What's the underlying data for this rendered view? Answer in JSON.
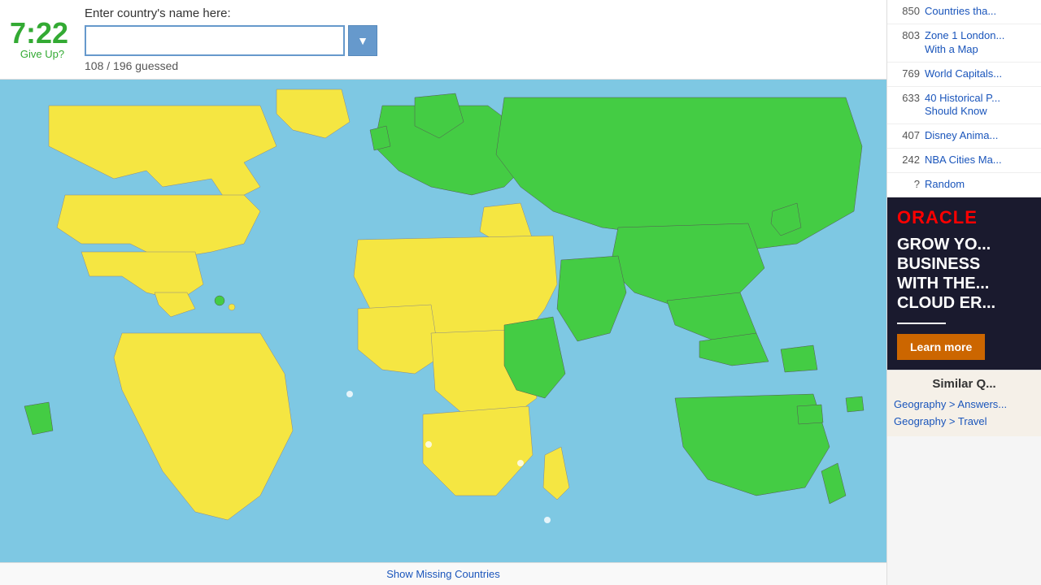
{
  "timer": {
    "display": "7:22",
    "color": "#33aa33"
  },
  "give_up": "Give Up?",
  "input": {
    "label": "Enter country's name here:",
    "placeholder": "",
    "value": ""
  },
  "progress": {
    "guessed": 108,
    "total": 196,
    "text": "108 / 196 guessed"
  },
  "dropdown_arrow": "▼",
  "sidebar": {
    "quiz_items": [
      {
        "count": "850",
        "label": "Countries tha..."
      },
      {
        "count": "803",
        "label": "Zone 1 London... With a Map"
      },
      {
        "count": "769",
        "label": "World Capitals..."
      },
      {
        "count": "633",
        "label": "40 Historical P... Should Know"
      },
      {
        "count": "407",
        "label": "Disney Anima..."
      },
      {
        "count": "242",
        "label": "NBA Cities Ma..."
      },
      {
        "count": "?",
        "label": "Random"
      }
    ],
    "ad": {
      "logo": "ORACLE",
      "text": "GROW YO... BUSINESS WITH THE... CLOUD ER...",
      "button": "Learn more"
    },
    "similar": {
      "title": "Similar Q...",
      "links": [
        "Geography > Answers...",
        "Geography > Travel"
      ]
    }
  },
  "show_missing": "Show Missing Countries"
}
